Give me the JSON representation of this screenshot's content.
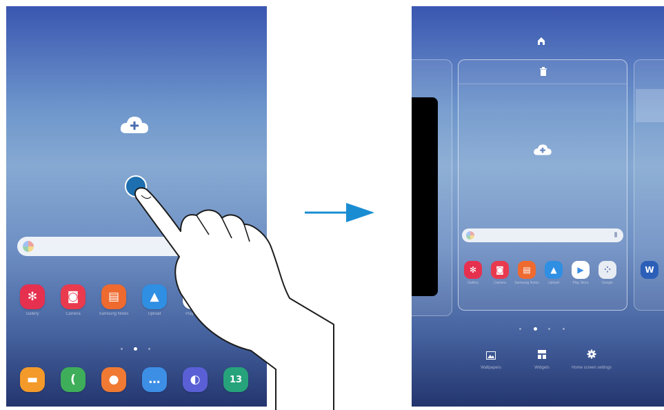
{
  "left_screen": {
    "apps": [
      {
        "label": "Gallery",
        "icon": "gallery-icon",
        "color": "#e6304f",
        "glyph": "✻"
      },
      {
        "label": "Camera",
        "icon": "camera-icon",
        "color": "#e93a4e",
        "glyph": "◙"
      },
      {
        "label": "Samsung Notes",
        "icon": "notes-icon",
        "color": "#ee6a2f",
        "glyph": "▤"
      },
      {
        "label": "Upload",
        "icon": "upload-icon",
        "color": "#2f8fe3",
        "glyph": "▲"
      },
      {
        "label": "Play Store",
        "icon": "play-store-icon",
        "color": "#ffffff",
        "glyph": "▶"
      }
    ],
    "dock": [
      {
        "label": "My Files",
        "icon": "folder-icon",
        "color": "#f39a2a",
        "glyph": "▬"
      },
      {
        "label": "Phone",
        "icon": "phone-icon",
        "color": "#3fae5a",
        "glyph": "("
      },
      {
        "label": "Contacts",
        "icon": "contacts-icon",
        "color": "#f07a33",
        "glyph": "●"
      },
      {
        "label": "Messages",
        "icon": "messages-icon",
        "color": "#3d8fe6",
        "glyph": "…"
      },
      {
        "label": "Internet",
        "icon": "internet-icon",
        "color": "#5a5fd6",
        "glyph": "◐"
      },
      {
        "label": "Calendar",
        "icon": "calendar-icon",
        "color": "#26a37a",
        "glyph": "13"
      }
    ]
  },
  "right_screen": {
    "apps": [
      {
        "label": "Gallery",
        "icon": "gallery-icon",
        "color": "#e6304f",
        "glyph": "✻"
      },
      {
        "label": "Camera",
        "icon": "camera-icon",
        "color": "#e93a4e",
        "glyph": "◙"
      },
      {
        "label": "Samsung Notes",
        "icon": "notes-icon",
        "color": "#ee6a2f",
        "glyph": "▤"
      },
      {
        "label": "Upload",
        "icon": "upload-icon",
        "color": "#2f8fe3",
        "glyph": "▲"
      },
      {
        "label": "Play Store",
        "icon": "play-store-icon",
        "color": "#ffffff",
        "glyph": "▶"
      },
      {
        "label": "Google",
        "icon": "google-folder-icon",
        "color": "#e8ecf3",
        "glyph": "⁘"
      }
    ],
    "next_page_app": {
      "label": "Word",
      "icon": "word-icon",
      "color": "#2b5fb8",
      "glyph": "W"
    },
    "bottom_options": [
      {
        "label": "Wallpapers",
        "icon": "wallpaper-icon",
        "glyph": "▲"
      },
      {
        "label": "Widgets",
        "icon": "widgets-icon",
        "glyph": "▦"
      },
      {
        "label": "Home screen settings",
        "icon": "settings-icon",
        "glyph": "✱"
      }
    ]
  }
}
